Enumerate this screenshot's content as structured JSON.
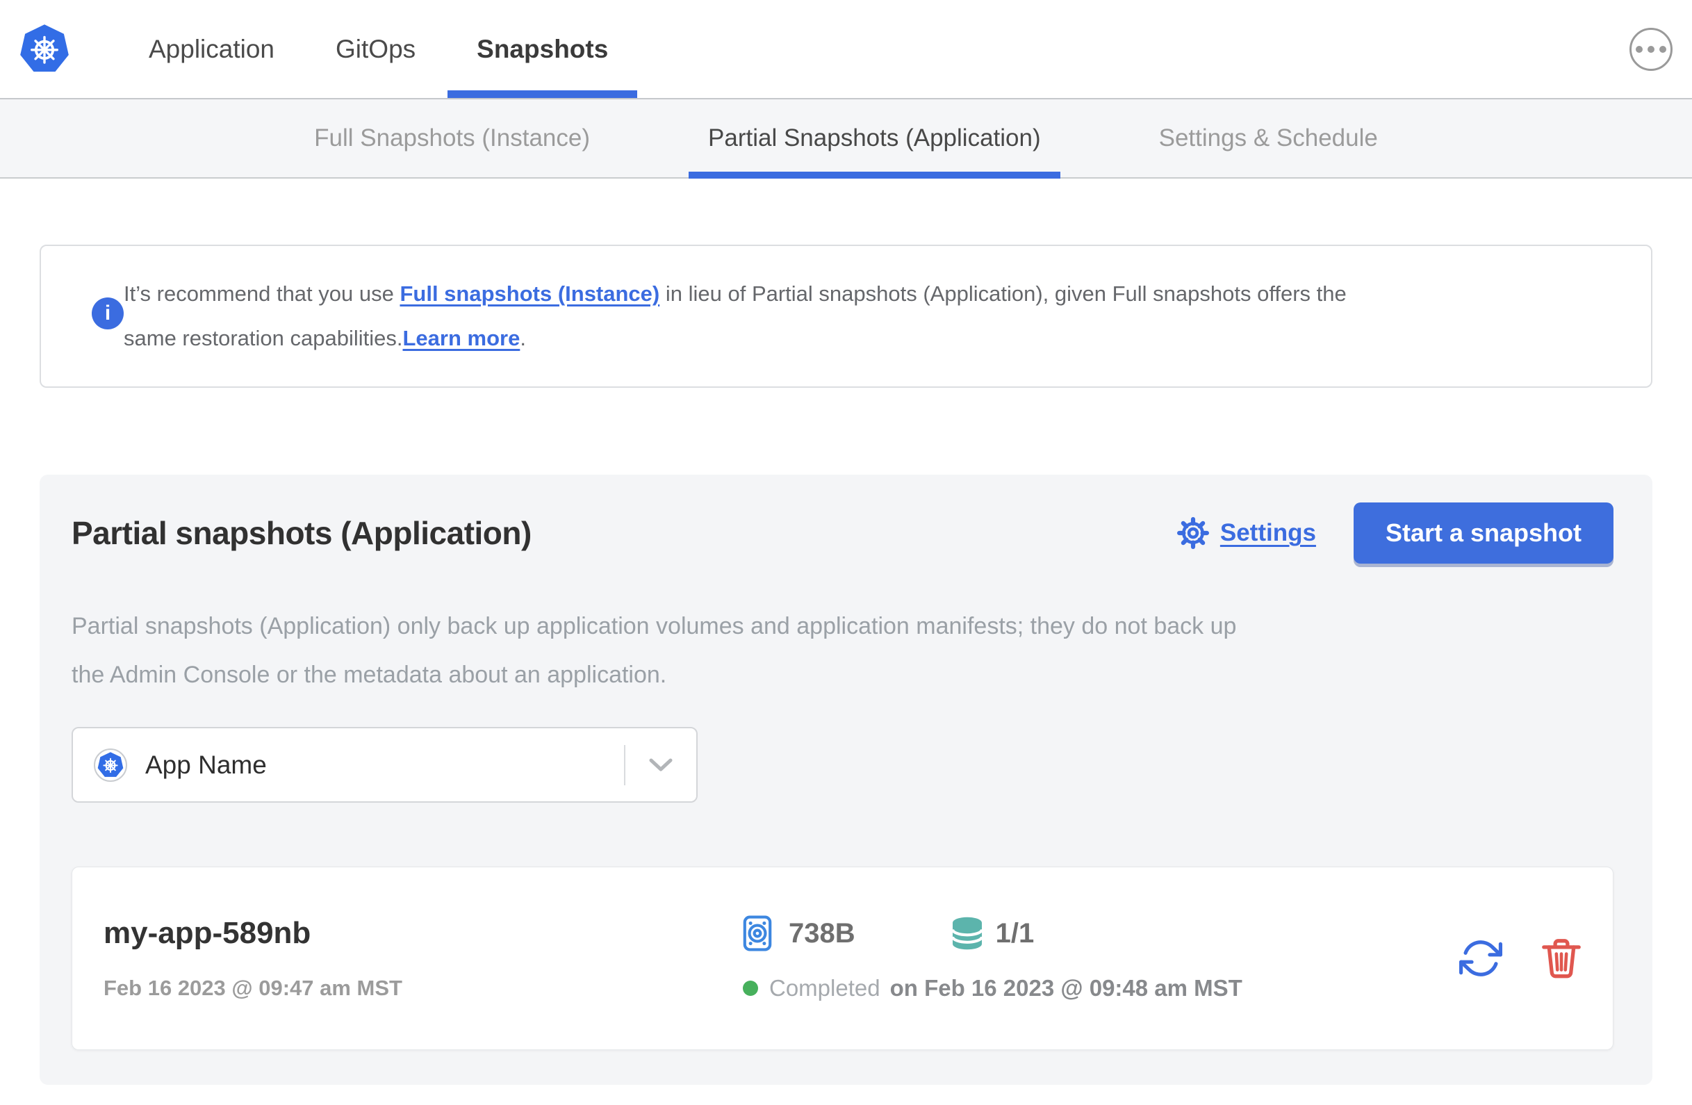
{
  "top_nav": {
    "items": [
      {
        "label": "Application",
        "active": false
      },
      {
        "label": "GitOps",
        "active": false
      },
      {
        "label": "Snapshots",
        "active": true
      }
    ]
  },
  "sub_nav": {
    "tabs": [
      {
        "label": "Full Snapshots (Instance)",
        "active": false
      },
      {
        "label": "Partial Snapshots (Application)",
        "active": true
      },
      {
        "label": "Settings & Schedule",
        "active": false
      }
    ]
  },
  "banner": {
    "line1": {
      "text_before": "It’s recommend that you use ",
      "link_label": "Full snapshots (Instance)",
      "text_after": " in lieu of Partial snapshots (Application), given Full snapshots offers the"
    },
    "line2": {
      "text_before": "same restoration capabilities.",
      "link_label": "Learn more",
      "text_after": "."
    }
  },
  "panel": {
    "title": "Partial snapshots (Application)",
    "settings_label": "Settings",
    "start_button_label": "Start a snapshot",
    "description_line1": "Partial snapshots (Application) only back up application volumes and application manifests; they do not back up",
    "description_line2": "the Admin Console or the metadata about an application.",
    "app_selector": {
      "value": "App Name"
    },
    "snapshot": {
      "name": "my-app-589nb",
      "started": "Feb 16 2023 @ 09:47 am MST",
      "size": "738B",
      "volumes": "1/1",
      "status": "Completed",
      "finished": "on Feb 16 2023 @ 09:48 am MST"
    }
  },
  "icons": {
    "info_glyph": "i"
  },
  "colors": {
    "accent_blue": "#3b6ce0",
    "kubernetes_blue": "#326de6",
    "disk_blue": "#3d87e0",
    "teal": "#5cb4ac",
    "success_green": "#47b05c",
    "danger_red": "#e0574f",
    "text_dark": "#323232",
    "text_gray": "#9aa0a6"
  }
}
